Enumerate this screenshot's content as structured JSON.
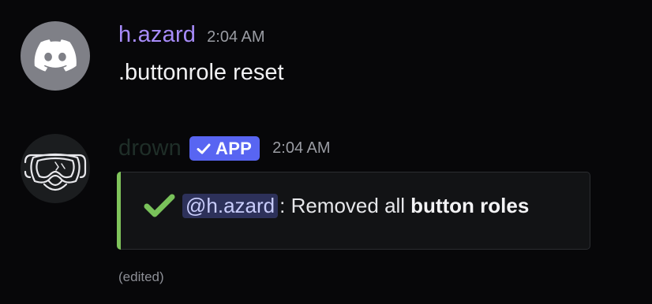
{
  "messages": [
    {
      "username": "h.azard",
      "timestamp": "2:04 AM",
      "text": ".buttonrole reset",
      "avatar_icon": "discord-logo-icon"
    },
    {
      "username": "drown",
      "badge_label": "APP",
      "timestamp": "2:04 AM",
      "avatar_icon": "snorkel-mask-icon",
      "embed": {
        "mention": "@h.azard",
        "text": ": Removed all",
        "bold_text": "button roles"
      },
      "edited_label": "(edited)"
    }
  ],
  "colors": {
    "username_1": "#a78bfa",
    "username_2": "#1f2e28",
    "badge": "#5865f2",
    "embed_accent": "#7fc35b",
    "check": "#79c25a"
  }
}
